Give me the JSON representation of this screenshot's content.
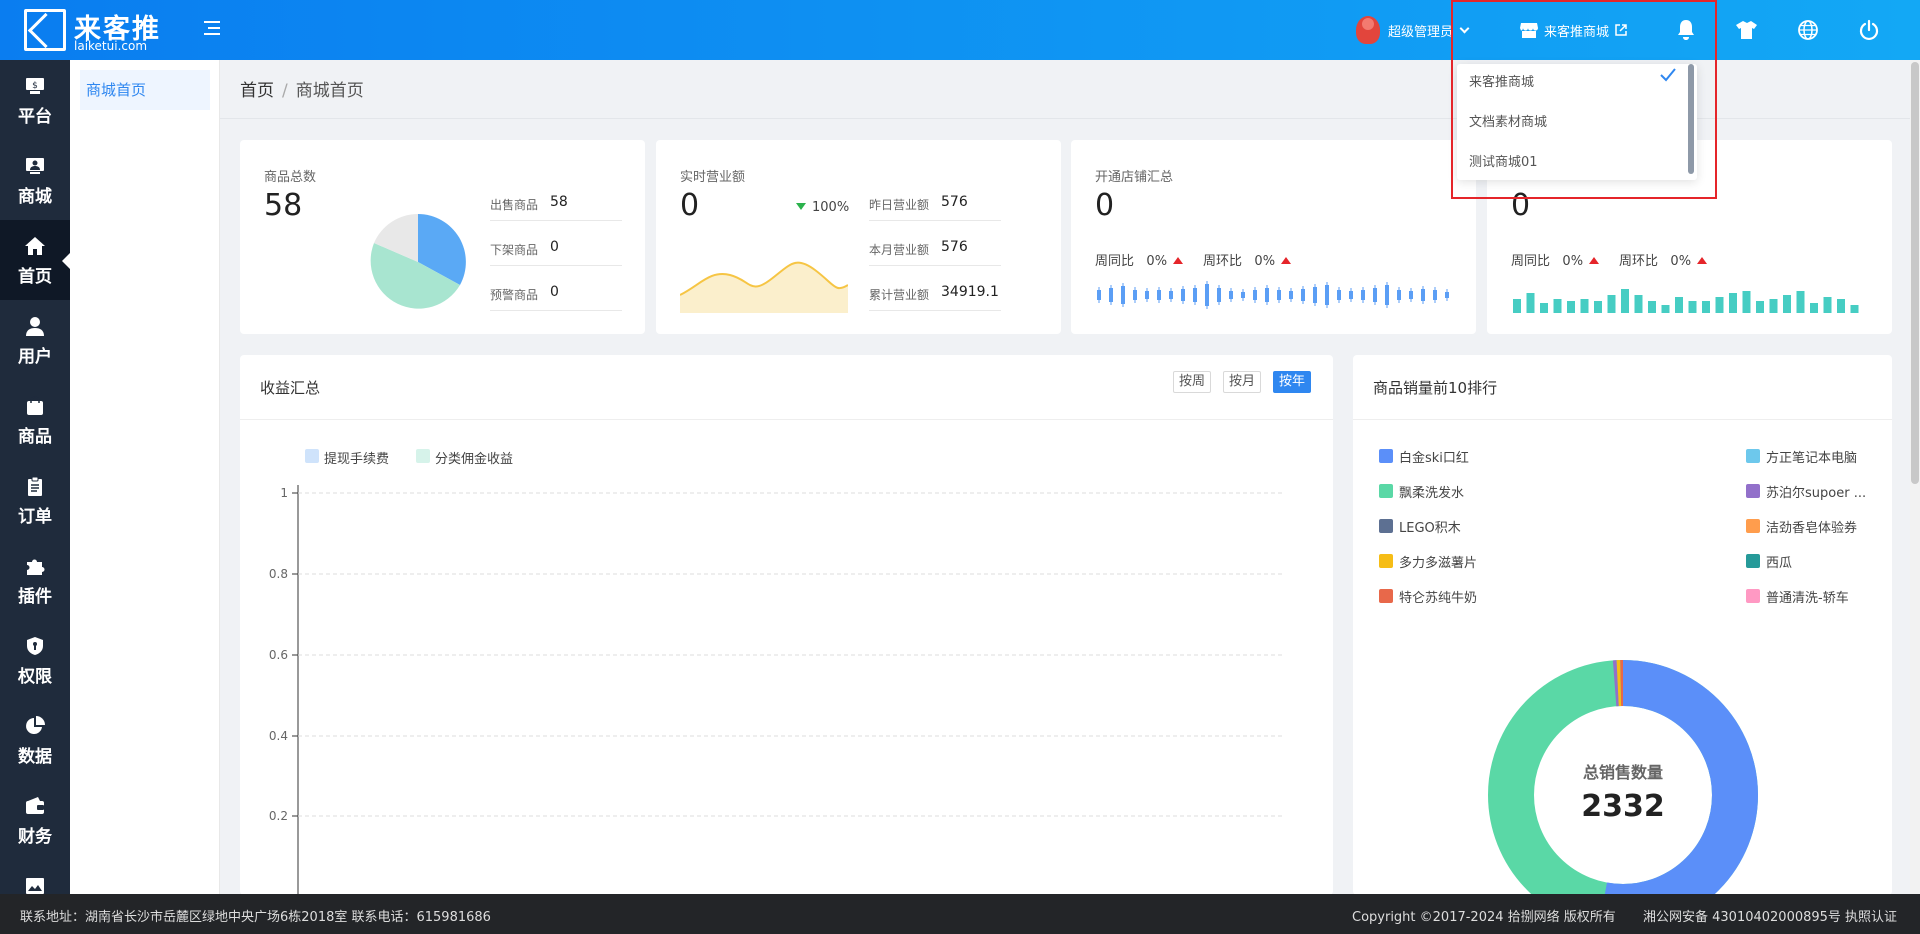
{
  "brand": {
    "name": "来客推",
    "domain": "laiketui.com"
  },
  "topbar": {
    "user": "超级管理员",
    "store_label": "来客推商城"
  },
  "store_dropdown": {
    "options": [
      {
        "label": "来客推商城",
        "selected": true
      },
      {
        "label": "文档素材商城",
        "selected": false
      },
      {
        "label": "测试商城01",
        "selected": false
      }
    ]
  },
  "sidebar": {
    "items": [
      {
        "label": "平台",
        "icon": "platform-icon"
      },
      {
        "label": "商城",
        "icon": "store-icon"
      },
      {
        "label": "首页",
        "icon": "home-icon",
        "active": true
      },
      {
        "label": "用户",
        "icon": "user-icon"
      },
      {
        "label": "商品",
        "icon": "bag-icon"
      },
      {
        "label": "订单",
        "icon": "clipboard-icon"
      },
      {
        "label": "插件",
        "icon": "puzzle-icon"
      },
      {
        "label": "权限",
        "icon": "shield-icon"
      },
      {
        "label": "数据",
        "icon": "pie-icon"
      },
      {
        "label": "财务",
        "icon": "wallet-icon"
      },
      {
        "label": "",
        "icon": "image-icon"
      }
    ]
  },
  "subnav": {
    "items": [
      "商城首页"
    ]
  },
  "breadcrumb": {
    "home": "首页",
    "current": "商城首页"
  },
  "cards": {
    "goods": {
      "title": "商品总数",
      "total": "58",
      "rows": [
        {
          "label": "出售商品",
          "value": "58"
        },
        {
          "label": "下架商品",
          "value": "0"
        },
        {
          "label": "预警商品",
          "value": "0"
        }
      ]
    },
    "revenue": {
      "title": "实时营业额",
      "total": "0",
      "change": "100%",
      "rows": [
        {
          "label": "昨日营业额",
          "value": "576"
        },
        {
          "label": "本月营业额",
          "value": "576"
        },
        {
          "label": "累计营业额",
          "value": "34919.1"
        }
      ]
    },
    "shops": {
      "title": "开通店铺汇总",
      "total": "0",
      "wow_label": "周同比",
      "wow": "0%",
      "mom_label": "周环比",
      "mom": "0%"
    },
    "fourth": {
      "total": "0",
      "wow_label": "周同比",
      "wow": "0%",
      "mom_label": "周环比",
      "mom": "0%"
    }
  },
  "income": {
    "title": "收益汇总",
    "buttons": [
      "按周",
      "按月",
      "按年"
    ],
    "active_button": "按年",
    "legend": [
      "提现手续费",
      "分类佣金收益"
    ],
    "colors": [
      "#cfe3fb",
      "#d6f3ea"
    ]
  },
  "ranking": {
    "title": "商品销量前10排行",
    "center_label": "总销售数量",
    "center_value": "2332",
    "items": [
      {
        "name": "白金ski口红",
        "color": "#5b8ff9"
      },
      {
        "name": "方正笔记本电脑",
        "color": "#6dc8ec"
      },
      {
        "name": "飘柔洗发水",
        "color": "#5ad8a6"
      },
      {
        "name": "苏泊尔supoer ...",
        "color": "#9270ca"
      },
      {
        "name": "LEGO积木",
        "color": "#5d7092"
      },
      {
        "name": "洁劲香皂体验券",
        "color": "#ff9d4d"
      },
      {
        "name": "多力多滋薯片",
        "color": "#f6bd16"
      },
      {
        "name": "西瓜",
        "color": "#269a99"
      },
      {
        "name": "特仑苏纯牛奶",
        "color": "#e8684a"
      },
      {
        "name": "普通清洗-轿车",
        "color": "#ff99c3"
      }
    ]
  },
  "chart_data": [
    {
      "type": "line",
      "title": "收益汇总",
      "series": [
        {
          "name": "提现手续费",
          "values": []
        },
        {
          "name": "分类佣金收益",
          "values": []
        }
      ],
      "yticks": [
        "1",
        "0.8",
        "0.6",
        "0.4",
        "0.2"
      ],
      "ylim": [
        0,
        1
      ],
      "grid": true,
      "legend": "top-left"
    },
    {
      "type": "pie",
      "title": "商品总数",
      "slices": [
        {
          "label": "出售商品",
          "value": 58,
          "color": "#5aa9f5"
        }
      ]
    }
  ],
  "footer": {
    "address": "联系地址：湖南省长沙市岳麓区绿地中央广场6栋2018室 联系电话：615981686",
    "copyright": "Copyright ©2017-2024 拾捌网络 版权所有",
    "icp": "湘公网安备 43010402000895号 执照认证"
  }
}
